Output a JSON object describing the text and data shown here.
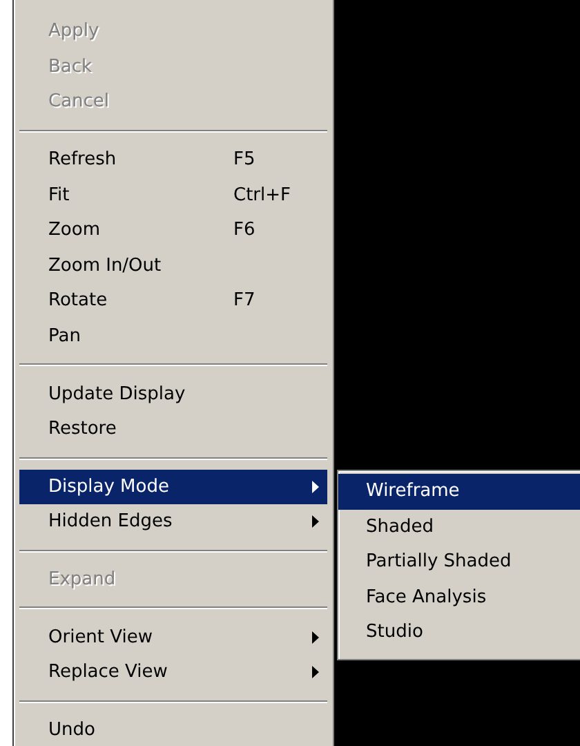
{
  "menu": {
    "items": [
      {
        "kind": "item",
        "label": "Apply",
        "disabled": true,
        "selected": false
      },
      {
        "kind": "item",
        "label": "Back",
        "disabled": true,
        "selected": false
      },
      {
        "kind": "item",
        "label": "Cancel",
        "disabled": true,
        "selected": false
      },
      {
        "kind": "separator"
      },
      {
        "kind": "item",
        "label": "Refresh",
        "shortcut": "F5",
        "disabled": false,
        "selected": false
      },
      {
        "kind": "item",
        "label": "Fit",
        "shortcut": "Ctrl+F",
        "disabled": false,
        "selected": false
      },
      {
        "kind": "item",
        "label": "Zoom",
        "shortcut": "F6",
        "disabled": false,
        "selected": false
      },
      {
        "kind": "item",
        "label": "Zoom In/Out",
        "disabled": false,
        "selected": false
      },
      {
        "kind": "item",
        "label": "Rotate",
        "shortcut": "F7",
        "disabled": false,
        "selected": false
      },
      {
        "kind": "item",
        "label": "Pan",
        "disabled": false,
        "selected": false
      },
      {
        "kind": "separator"
      },
      {
        "kind": "item",
        "label": "Update Display",
        "disabled": false,
        "selected": false
      },
      {
        "kind": "item",
        "label": "Restore",
        "disabled": false,
        "selected": false
      },
      {
        "kind": "separator"
      },
      {
        "kind": "submenu",
        "label": "Display Mode",
        "disabled": false,
        "selected": true
      },
      {
        "kind": "submenu",
        "label": "Hidden Edges",
        "disabled": false,
        "selected": false
      },
      {
        "kind": "separator"
      },
      {
        "kind": "item",
        "label": "Expand",
        "disabled": true,
        "selected": false
      },
      {
        "kind": "separator"
      },
      {
        "kind": "submenu",
        "label": "Orient View",
        "disabled": false,
        "selected": false
      },
      {
        "kind": "submenu",
        "label": "Replace View",
        "disabled": false,
        "selected": false
      },
      {
        "kind": "separator"
      },
      {
        "kind": "item",
        "label": "Undo",
        "disabled": false,
        "selected": false
      }
    ]
  },
  "submenu": {
    "items": [
      {
        "label": "Wireframe",
        "selected": true
      },
      {
        "label": "Shaded",
        "selected": false
      },
      {
        "label": "Partially Shaded",
        "selected": false
      },
      {
        "label": "Face Analysis",
        "selected": false
      },
      {
        "label": "Studio",
        "selected": false
      }
    ]
  }
}
